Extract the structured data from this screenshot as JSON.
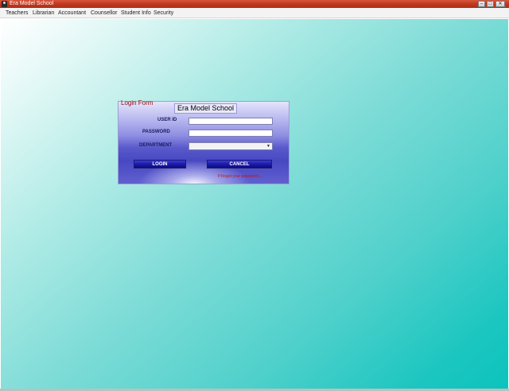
{
  "window": {
    "title": "Era Model School",
    "controls": {
      "minimize": "–",
      "maximize": "□",
      "close": "✕"
    }
  },
  "menu": {
    "items": [
      {
        "label": "Teachers"
      },
      {
        "label": "Librarian"
      },
      {
        "label": "Accountant"
      },
      {
        "label": "Counsellor"
      },
      {
        "label": "Student Info"
      },
      {
        "label": "Security"
      }
    ]
  },
  "login_form": {
    "legend": "Login Form",
    "school_title": "Era Model School",
    "user_id_label": "USER ID",
    "user_id_value": "",
    "password_label": "PASSWORD",
    "password_value": "",
    "department_label": "DEPARTMENT",
    "department_selected": "",
    "login_button": "LOGIN",
    "cancel_button": "CANCEL",
    "forgot_link": "If forgot your password ..."
  },
  "colors": {
    "title_bar": "#c0381f",
    "panel_dark": "#4848c2",
    "button": "#1c1ca8",
    "link": "#cc1010",
    "background_teal": "#0cc3bd"
  }
}
